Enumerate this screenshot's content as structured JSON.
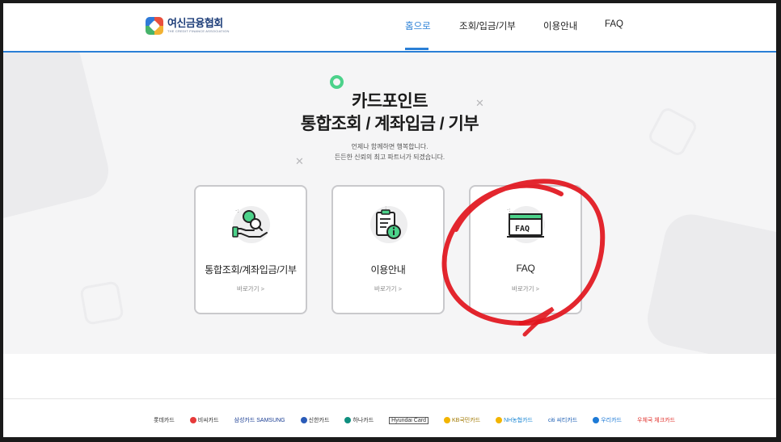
{
  "logo": {
    "title": "여신금융협회",
    "subtitle": "THE CREDIT FINANCE ASSOCIATION"
  },
  "nav": {
    "items": [
      {
        "label": "홈으로",
        "active": true
      },
      {
        "label": "조회/입금/기부",
        "active": false
      },
      {
        "label": "이용안내",
        "active": false
      },
      {
        "label": "FAQ",
        "active": false
      }
    ]
  },
  "hero": {
    "title_line1": "카드포인트",
    "title_line2": "통합조회 / 계좌입금 / 기부",
    "subtitle_line1": "언제나 함께하면 행복합니다.",
    "subtitle_line2": "든든한 신뢰의 최고 파트너가 되겠습니다."
  },
  "cards": [
    {
      "title": "통합조회/계좌입금/기부",
      "link": "바로가기 >",
      "icon": "hand-coin-search-icon"
    },
    {
      "title": "이용안내",
      "link": "바로가기 >",
      "icon": "clipboard-info-icon"
    },
    {
      "title": "FAQ",
      "link": "바로가기 >",
      "icon": "faq-window-icon"
    }
  ],
  "partners": [
    {
      "label": "롯데카드",
      "color": "#333333"
    },
    {
      "label": "비씨카드",
      "color": "#e63a3a"
    },
    {
      "label": "삼성카드 SAMSUNG",
      "color": "#1c3f94"
    },
    {
      "label": "신한카드",
      "color": "#2a5bb8"
    },
    {
      "label": "하나카드",
      "color": "#0f8f7f"
    },
    {
      "label": "Hyundai Card",
      "color": "#333333"
    },
    {
      "label": "KB국민카드",
      "color": "#f2b400"
    },
    {
      "label": "NH농협카드",
      "color": "#1e88d4"
    },
    {
      "label": "citi 씨티카드",
      "color": "#1d5fb4"
    },
    {
      "label": "우리카드",
      "color": "#1d7ad6"
    },
    {
      "label": "우체국 체크카드",
      "color": "#e0302b"
    }
  ],
  "colors": {
    "accent": "#2a7fd6",
    "green": "#4cd28a",
    "annotation_red": "#e1141c"
  }
}
